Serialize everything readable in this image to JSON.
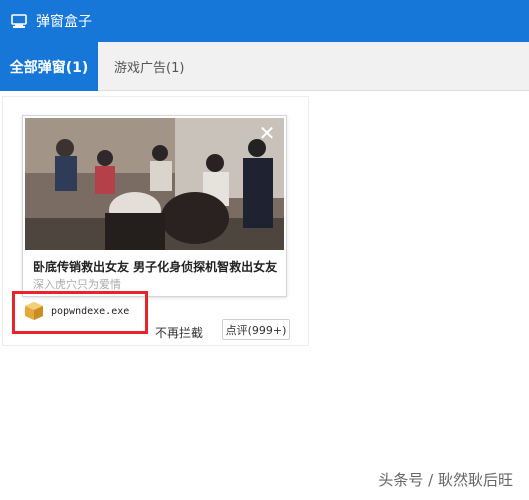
{
  "window": {
    "title": "弹窗盒子",
    "title_icon": "monitor-icon"
  },
  "tabs": [
    {
      "label": "全部弹窗(1)",
      "active": true
    },
    {
      "label": "游戏广告(1)",
      "active": false
    }
  ],
  "card": {
    "headline": "卧底传销救出女友 男子化身侦探机智救出女友",
    "subtext": "深入虎穴只为爱情",
    "close_icon": "close-icon"
  },
  "file": {
    "name": "popwndexe.exe",
    "icon": "package-icon"
  },
  "actions": {
    "no_block": "不再拦截",
    "review": "点评(999+)"
  },
  "watermark": "头条号 / 耿然耿后旺",
  "colors": {
    "accent": "#1677d9",
    "highlight": "#e8232a"
  }
}
